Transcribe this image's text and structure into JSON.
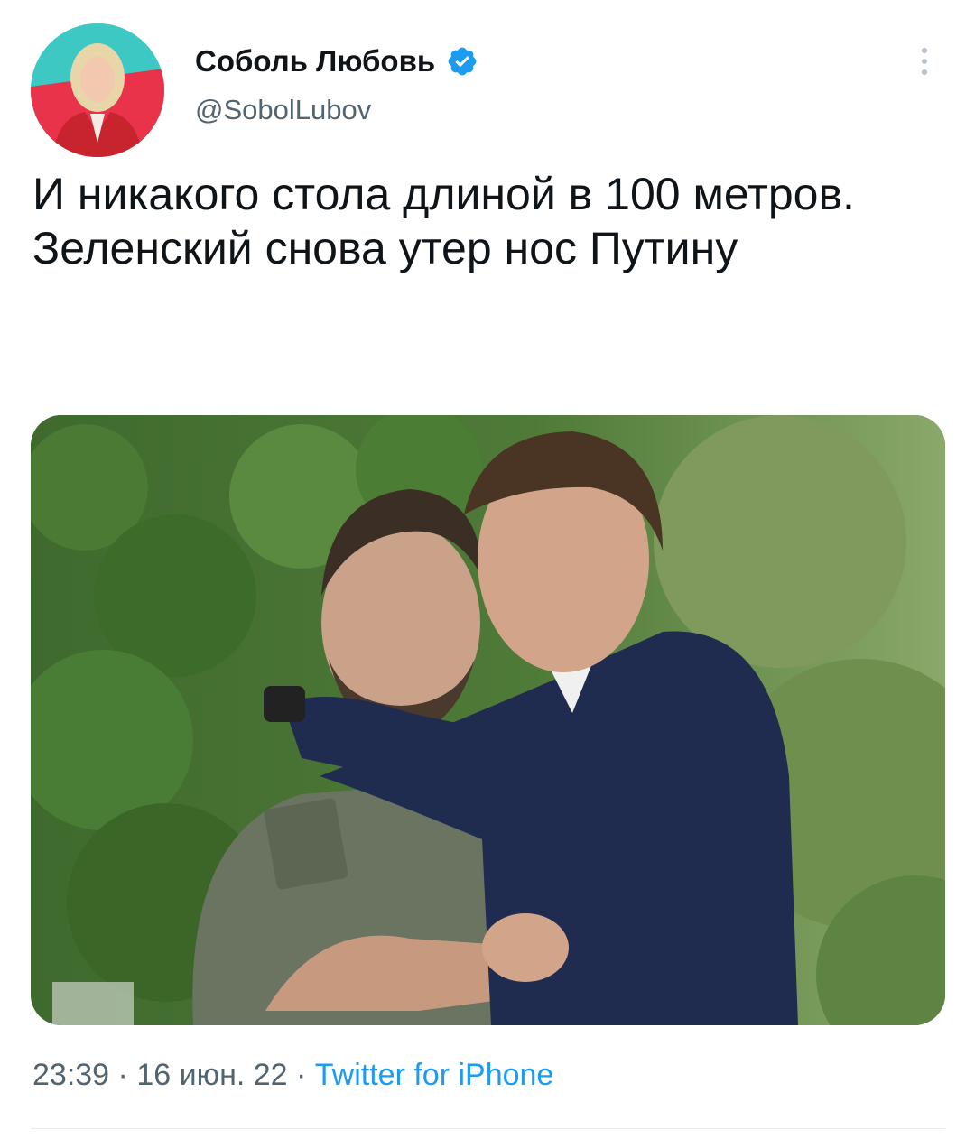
{
  "author": {
    "display_name": "Соболь Любовь",
    "handle": "@SobolLubov",
    "verified_icon": "verified-badge-icon",
    "avatar_icon": "avatar"
  },
  "tweet": {
    "text": "И никакого стола длиной в 100 метров. Зеленский снова утер нос Путину",
    "media_icon": "photo"
  },
  "meta": {
    "time": "23:39",
    "separator1": " · ",
    "date": "16 июн. 22",
    "separator2": " · ",
    "source": "Twitter for iPhone"
  },
  "colors": {
    "link": "#1d9bf0",
    "secondary_text": "#536471",
    "verified": "#1d9bf0",
    "divider": "#e6ecf0"
  },
  "actions": {
    "more_icon": "more-options-icon"
  }
}
